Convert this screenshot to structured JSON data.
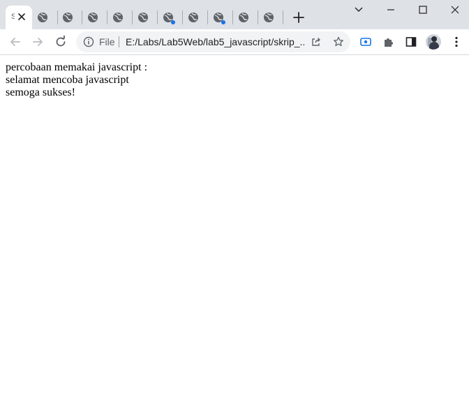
{
  "browser": {
    "tabs": [
      {
        "title": "",
        "active": true
      },
      {
        "title": "",
        "active": false
      },
      {
        "title": "",
        "active": false
      },
      {
        "title": "",
        "active": false
      },
      {
        "title": "",
        "active": false
      },
      {
        "title": "",
        "active": false
      },
      {
        "title": "",
        "active": false,
        "has_notification_dot": true
      },
      {
        "title": "",
        "active": false
      },
      {
        "title": "",
        "active": false,
        "has_notification_dot": true
      },
      {
        "title": "",
        "active": false
      },
      {
        "title": "",
        "active": false
      }
    ],
    "active_tab_favicon_glyph": "S",
    "omnibox": {
      "security_chip": "File",
      "url": "E:/Labs/Lab5Web/lab5_javascript/skrip_..."
    },
    "icons": {
      "tab_close": "close-icon",
      "tab_favicon": "globe-icon",
      "new_tab": "plus-icon",
      "window_search": "chevron-down-icon",
      "minimize": "minimize-icon",
      "maximize": "maximize-icon",
      "close_window": "close-icon",
      "back": "arrow-left-icon",
      "forward": "arrow-right-icon",
      "reload": "reload-icon",
      "info": "info-icon",
      "share": "share-icon",
      "bookmark": "star-icon",
      "cast": "cast-icon",
      "extensions": "puzzle-icon",
      "side_panel": "side-panel-icon",
      "profile": "avatar"
    },
    "colors": {
      "tabstrip_bg": "#dee1e6",
      "omnibox_bg": "#f1f3f4",
      "accent": "#1a73e8",
      "icon_gray": "#5f6368"
    }
  },
  "page": {
    "lines": [
      "percobaan memakai javascript :",
      "selamat mencoba javascript",
      "semoga sukses!"
    ]
  }
}
